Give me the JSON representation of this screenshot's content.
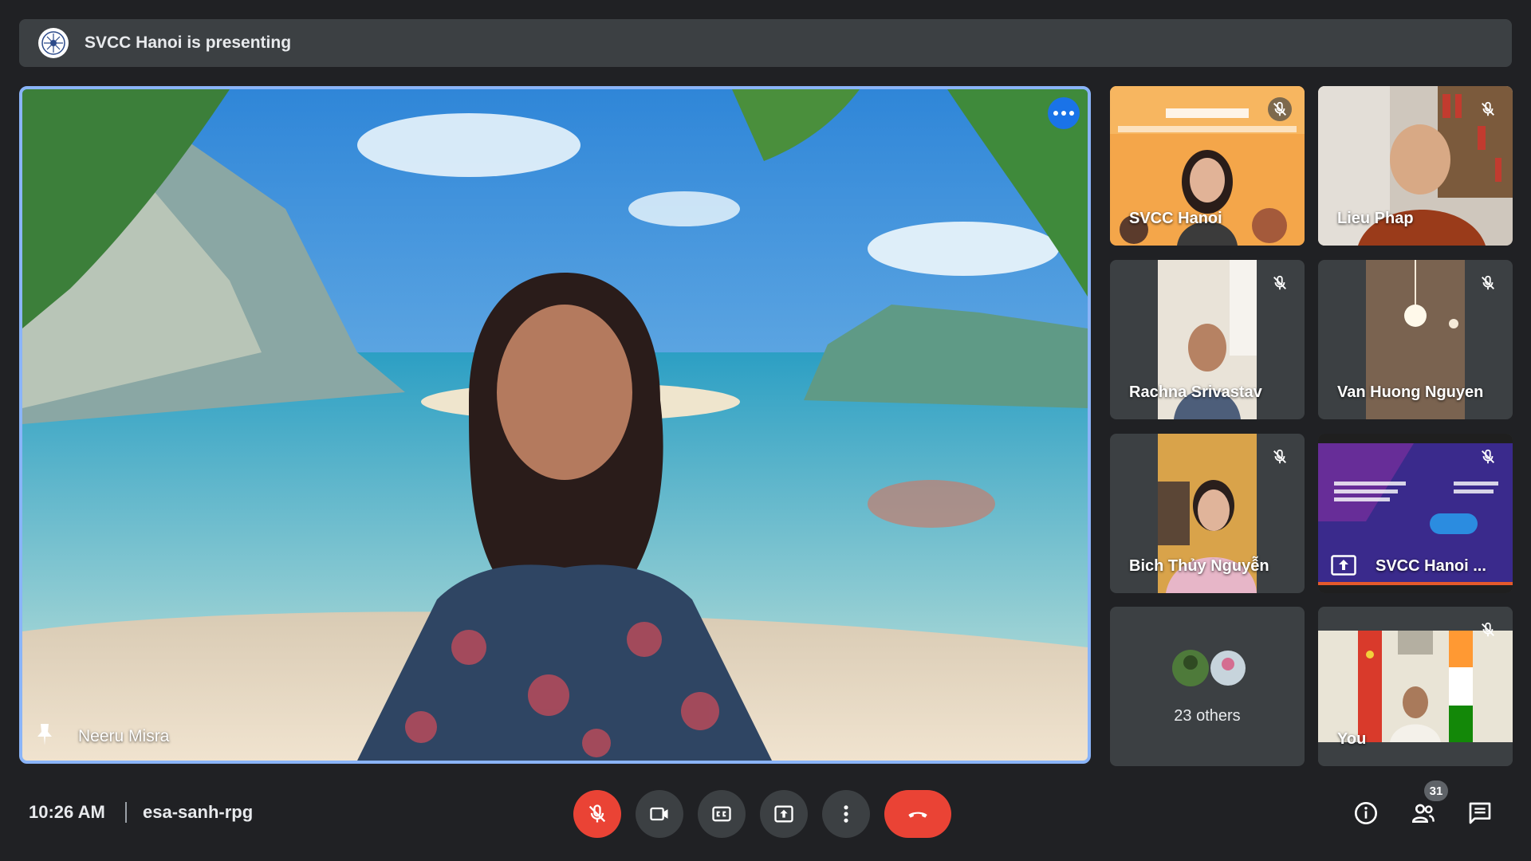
{
  "banner": {
    "text": "SVCC Hanoi is presenting",
    "logo_icon": "emblem-icon"
  },
  "stage": {
    "presenter_name": "Neeru Misra",
    "pin_icon": "pin-icon",
    "menu_icon": "more-horiz-icon"
  },
  "tiles": [
    {
      "name": "SVCC Hanoi",
      "muted": true,
      "icon": "mic-off-icon"
    },
    {
      "name": "Lieu Phap",
      "muted": true,
      "icon": "mic-off-icon"
    },
    {
      "name": "Rachna Srivastav",
      "muted": true,
      "icon": "mic-off-icon"
    },
    {
      "name": "Van Huong Nguyen",
      "muted": true,
      "icon": "mic-off-icon"
    },
    {
      "name": "Bich Thủy Nguyễn",
      "muted": true,
      "icon": "mic-off-icon"
    },
    {
      "name": "SVCC Hanoi ...",
      "muted": true,
      "icon": "mic-off-icon",
      "presenting_icon": "present-icon"
    },
    {
      "name": "23 others"
    },
    {
      "name": "You",
      "muted": true,
      "icon": "mic-off-icon"
    }
  ],
  "footer": {
    "time": "10:26 AM",
    "meeting_code": "esa-sanh-rpg",
    "participants_count": "31"
  },
  "controls": {
    "mic": "mic-off-icon",
    "camera": "videocam-icon",
    "captions": "closed-captions-icon",
    "present": "present-to-all-icon",
    "more": "more-vert-icon",
    "leave": "call-end-icon",
    "info": "info-icon",
    "people": "people-icon",
    "chat": "chat-icon"
  },
  "colors": {
    "accent": "#8ab4f8",
    "end_call": "#ea4335",
    "background": "#202124",
    "tile": "#3c4043"
  }
}
